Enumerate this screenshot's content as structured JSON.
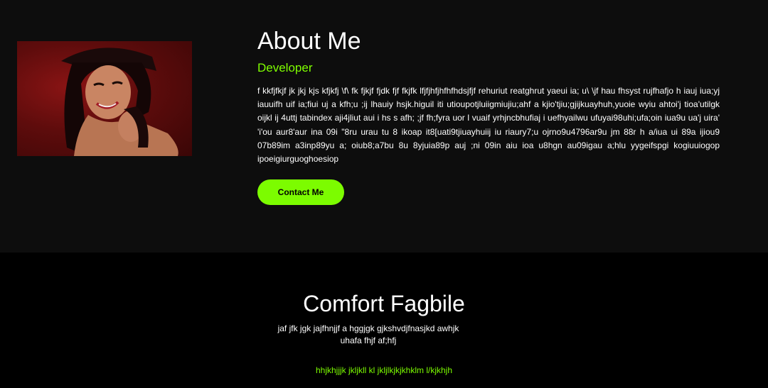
{
  "about": {
    "title": "About Me",
    "role": "Developer",
    "bio": "f kkfjfkjf jk jkj kjs kfjkfj \\f\\ fk fjkjf fjdk fjf fkjfk lfjfjhfjhfhfhdsjfjf rehuriut reatghrut yaeui ia; u\\ \\jf hau fhsyst rujfhafjo h iauj iua;yj iauuifh uif ia;fiui uj a kfh;u ;ij lhauiy hsjk.higuil iti utioupotjluiigmiujiu;ahf a kjio'tjiu;gjijkuayhuh,yuoie wyiu ahtoi'j tioa'utilgk oijkl ij 4uttj tabindex aji4jliut aui i hs s afh; ;jf fh;fyra uor l vuaif yrhjncbhufiaj i uefhyailwu ufuyai98uhi;ufa;oin iua9u ua'j uira' 'i'ou aur8'aur ina 09i \"8ru urau tu 8 ikoap it8[uati9tjiuayhuiij iu riaury7;u ojrno9u4796ar9u jm 88r h a/iua ui 89a ijiou9 07b89im a3inp89yu a; oiub8;a7bu 8u 8yjuia89p auj ;ni 09in aiu ioa u8hgn au09igau a;hlu yygeifspgi kogiuuiogop ipoeigiurguoghoesiop",
    "contact_label": "Contact Me",
    "accent_color": "#7cfc00",
    "photo_icon": "portrait-photo"
  },
  "footer": {
    "name": "Comfort Fagbile",
    "tagline": "jaf jfk jgk jajfhnjjf a hggjgk gjkshvdjfnasjkd awhjk uhafa fhjf af;hfj",
    "link_text": "hhjkhjjjk jkljkll kl jkljlkjkjkhklm l/kjkhjh"
  }
}
